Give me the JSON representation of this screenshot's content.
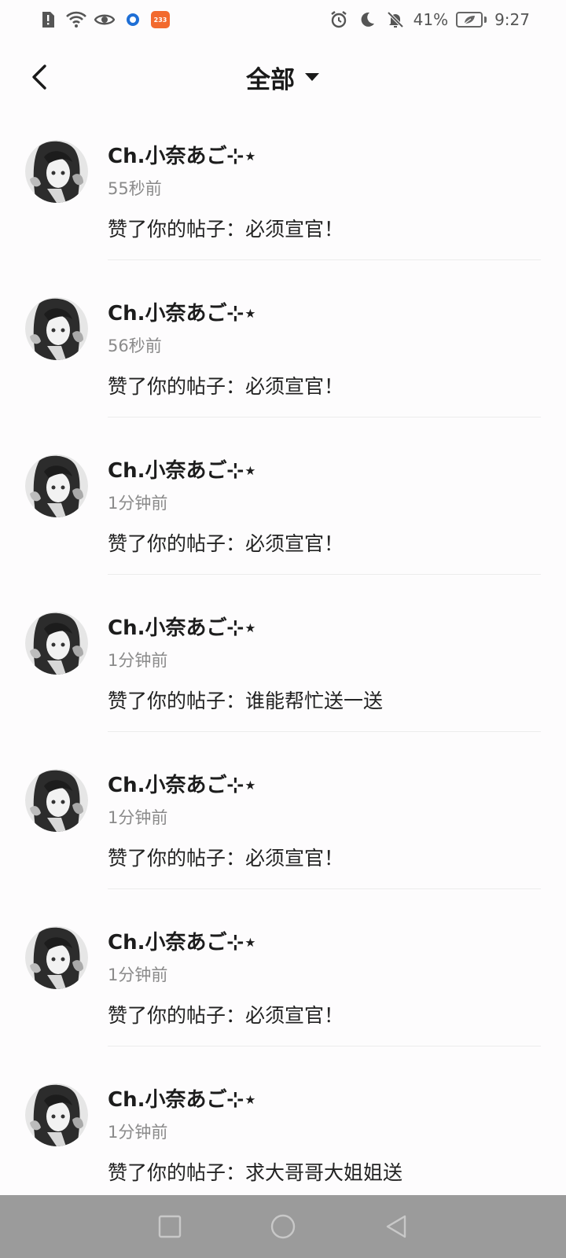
{
  "status_bar": {
    "app_badge": "233",
    "battery": "41%",
    "time": "9:27"
  },
  "header": {
    "title": "全部"
  },
  "notifications": [
    {
      "user": "Ch.小奈あご⊹⋆",
      "time": "55秒前",
      "content": "赞了你的帖子：必须宣官！"
    },
    {
      "user": "Ch.小奈あご⊹⋆",
      "time": "56秒前",
      "content": "赞了你的帖子：必须宣官！"
    },
    {
      "user": "Ch.小奈あご⊹⋆",
      "time": "1分钟前",
      "content": "赞了你的帖子：必须宣官！"
    },
    {
      "user": "Ch.小奈あご⊹⋆",
      "time": "1分钟前",
      "content": "赞了你的帖子：谁能帮忙送一送"
    },
    {
      "user": "Ch.小奈あご⊹⋆",
      "time": "1分钟前",
      "content": "赞了你的帖子：必须宣官！"
    },
    {
      "user": "Ch.小奈あご⊹⋆",
      "time": "1分钟前",
      "content": "赞了你的帖子：必须宣官！"
    },
    {
      "user": "Ch.小奈あご⊹⋆",
      "time": "1分钟前",
      "content": "赞了你的帖子：求大哥哥大姐姐送"
    }
  ],
  "icons": {
    "back": "back-arrow-icon",
    "dropdown": "caret-down-icon",
    "nav": [
      "recents-square-icon",
      "home-circle-icon",
      "back-triangle-icon"
    ]
  }
}
